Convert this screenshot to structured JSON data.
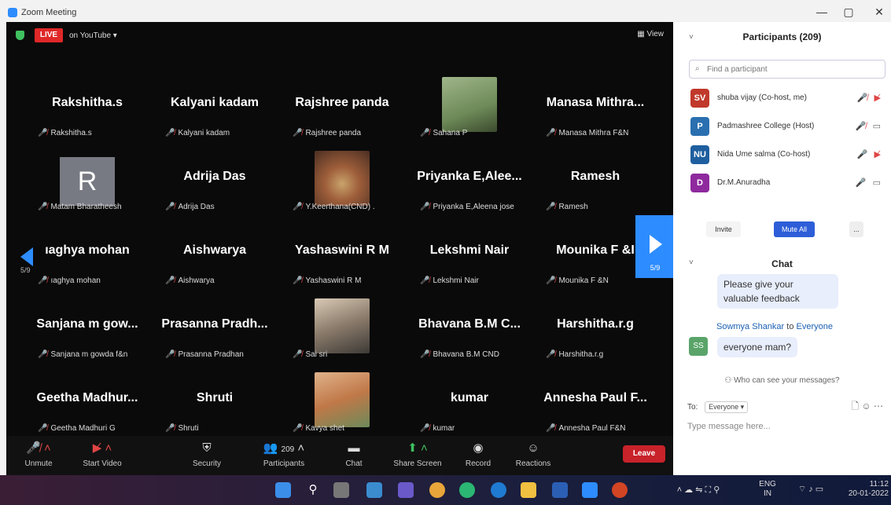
{
  "window": {
    "title": "Zoom Meeting",
    "min": "—",
    "max": "▢",
    "close": "✕"
  },
  "meeting": {
    "live_label": "LIVE",
    "stream": "on YouTube ▾",
    "view": "View",
    "page_left": "5/9",
    "page_right": "5/9"
  },
  "tiles": [
    {
      "big": "Rakshitha.s",
      "small": "Rakshitha.s"
    },
    {
      "big": "Kalyani kadam",
      "small": "Kalyani kadam"
    },
    {
      "big": "Rajshree panda",
      "small": "Rajshree panda"
    },
    {
      "big": "",
      "small": "Sahana P",
      "photo": "girl-photo"
    },
    {
      "big": "Manasa  Mithra...",
      "small": "Manasa Mithra F&N"
    },
    {
      "big": "",
      "small": "Matam Bharatheesh",
      "avatar": "R"
    },
    {
      "big": "Adrija Das",
      "small": "Adrija Das"
    },
    {
      "big": "",
      "small": "Y.Keerthana(CND) .",
      "photo": "food-photo"
    },
    {
      "big": "Priyanka  E,Alee...",
      "small": "Priyanka E,Aleena jose"
    },
    {
      "big": "Ramesh",
      "small": "Ramesh"
    },
    {
      "big": "ıaghya mohan",
      "small": "ıaghya mohan"
    },
    {
      "big": "Aishwarya",
      "small": "Aishwarya"
    },
    {
      "big": "Yashaswini R M",
      "small": "Yashaswini R M"
    },
    {
      "big": "Lekshmi  Nair",
      "small": "Lekshmi  Nair"
    },
    {
      "big": "Mounika F &I",
      "small": "Mounika F &N"
    },
    {
      "big": "Sanjana m gow...",
      "small": "Sanjana m gowda f&n"
    },
    {
      "big": "Prasanna  Pradh...",
      "small": "Prasanna Pradhan"
    },
    {
      "big": "",
      "small": "Sai sri",
      "photo": "person-photo"
    },
    {
      "big": "Bhavana B.M  C...",
      "small": "Bhavana B.M CND"
    },
    {
      "big": "Harshitha.r.g",
      "small": "Harshitha.r.g"
    },
    {
      "big": "Geetha  Madhur...",
      "small": "Geetha Madhuri  G"
    },
    {
      "big": "Shruti",
      "small": "Shruti"
    },
    {
      "big": "",
      "small": "Kavya shet",
      "photo": "woman-photo"
    },
    {
      "big": "kumar",
      "small": "kumar"
    },
    {
      "big": "Annesha Paul  F...",
      "small": "Annesha Paul F&N"
    }
  ],
  "toolbar": {
    "unmute": "Unmute",
    "start_video": "Start Video",
    "security": "Security",
    "participants": "Participants",
    "participants_count": "209",
    "chat": "Chat",
    "share_screen": "Share Screen",
    "record": "Record",
    "reactions": "Reactions",
    "leave": "Leave"
  },
  "participants_panel": {
    "title": "Participants (209)",
    "search_placeholder": "Find a participant",
    "list": [
      {
        "initials": "SV",
        "name": "shuba vijay (Co-host, me)",
        "color": "#c0392b"
      },
      {
        "initials": "P",
        "name": "Padmashree College (Host)",
        "color": "#2a6fb0"
      },
      {
        "initials": "NU",
        "name": "Nida Ume salma (Co-host)",
        "color": "#1f5f9f"
      },
      {
        "initials": "D",
        "name": "Dr.M.Anuradha",
        "color": "#8e2a9e"
      }
    ],
    "invite": "Invite",
    "mute_all": "Mute All",
    "more": "..."
  },
  "chat": {
    "title": "Chat",
    "msg1": "Please give your\nvaluable feedback",
    "sender": "Sowmya Shankar",
    "to_word": "to",
    "recipient": "Everyone",
    "sender_initials": "SS",
    "msg2": "everyone mam?",
    "who_can_see": "Who can see your messages?",
    "to_label": "To:",
    "to_value": "Everyone ▾",
    "input_placeholder": "Type message here..."
  },
  "taskbar": {
    "lang": "ENG",
    "region": "IN",
    "time": "11:12",
    "date": "20-01-2022"
  },
  "colors": {
    "zoom_blue": "#2d8cff",
    "live_red": "#e02828",
    "leave_red": "#c8222a"
  }
}
